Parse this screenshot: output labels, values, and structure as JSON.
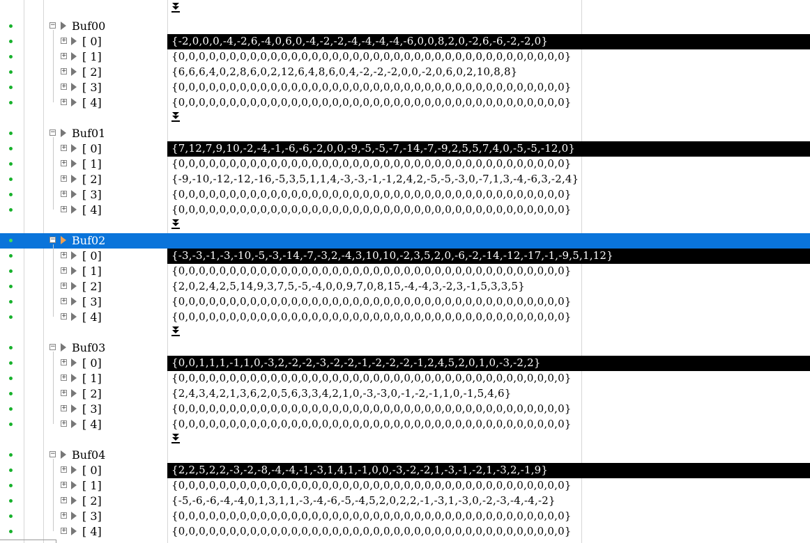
{
  "selected_group": "Buf02",
  "groups": [
    {
      "name": "Buf00",
      "items": [
        {
          "label": "[ 0]",
          "value": "{-2,0,0,0,-4,-2,6,-4,0,6,0,-4,-2,-2,-4,-4,-4,-4,-6,0,0,8,2,0,-2,6,-6,-2,-2,0}",
          "highlight": true
        },
        {
          "label": "[ 1]",
          "value": "{0,0,0,0,0,0,0,0,0,0,0,0,0,0,0,0,0,0,0,0,0,0,0,0,0,0,0,0,0,0,0,0,0,0,0,0,0,0}",
          "highlight": false
        },
        {
          "label": "[ 2]",
          "value": "{6,6,6,4,0,2,8,6,0,2,12,6,4,8,6,0,4,-2,-2,-2,0,0,-2,0,6,0,2,10,8,8}",
          "highlight": false
        },
        {
          "label": "[ 3]",
          "value": "{0,0,0,0,0,0,0,0,0,0,0,0,0,0,0,0,0,0,0,0,0,0,0,0,0,0,0,0,0,0,0,0,0,0,0,0,0,0}",
          "highlight": false
        },
        {
          "label": "[ 4]",
          "value": "{0,0,0,0,0,0,0,0,0,0,0,0,0,0,0,0,0,0,0,0,0,0,0,0,0,0,0,0,0,0,0,0,0,0,0,0,0,0}",
          "highlight": false
        }
      ]
    },
    {
      "name": "Buf01",
      "items": [
        {
          "label": "[ 0]",
          "value": "{7,12,7,9,10,-2,-4,-1,-6,-6,-2,0,0,-9,-5,-5,-7,-14,-7,-9,2,5,5,7,4,0,-5,-5,-12,0}",
          "highlight": true
        },
        {
          "label": "[ 1]",
          "value": "{0,0,0,0,0,0,0,0,0,0,0,0,0,0,0,0,0,0,0,0,0,0,0,0,0,0,0,0,0,0,0,0,0,0,0,0,0,0}",
          "highlight": false
        },
        {
          "label": "[ 2]",
          "value": "{-9,-10,-12,-12,-16,-5,3,5,1,1,4,-3,-3,-1,-1,2,4,2,-5,-5,-3,0,-7,1,3,-4,-6,3,-2,4}",
          "highlight": false
        },
        {
          "label": "[ 3]",
          "value": "{0,0,0,0,0,0,0,0,0,0,0,0,0,0,0,0,0,0,0,0,0,0,0,0,0,0,0,0,0,0,0,0,0,0,0,0,0,0}",
          "highlight": false
        },
        {
          "label": "[ 4]",
          "value": "{0,0,0,0,0,0,0,0,0,0,0,0,0,0,0,0,0,0,0,0,0,0,0,0,0,0,0,0,0,0,0,0,0,0,0,0,0,0}",
          "highlight": false
        }
      ]
    },
    {
      "name": "Buf02",
      "items": [
        {
          "label": "[ 0]",
          "value": "{-3,-3,-1,-3,-10,-5,-3,-14,-7,-3,2,-4,3,10,10,-2,3,5,2,0,-6,-2,-14,-12,-17,-1,-9,5,1,12}",
          "highlight": true
        },
        {
          "label": "[ 1]",
          "value": "{0,0,0,0,0,0,0,0,0,0,0,0,0,0,0,0,0,0,0,0,0,0,0,0,0,0,0,0,0,0,0,0,0,0,0,0,0,0}",
          "highlight": false
        },
        {
          "label": "[ 2]",
          "value": "{2,0,2,4,2,5,14,9,3,7,5,-5,-4,0,0,9,7,0,8,15,-4,-4,3,-2,3,-1,5,3,3,5}",
          "highlight": false
        },
        {
          "label": "[ 3]",
          "value": "{0,0,0,0,0,0,0,0,0,0,0,0,0,0,0,0,0,0,0,0,0,0,0,0,0,0,0,0,0,0,0,0,0,0,0,0,0,0}",
          "highlight": false
        },
        {
          "label": "[ 4]",
          "value": "{0,0,0,0,0,0,0,0,0,0,0,0,0,0,0,0,0,0,0,0,0,0,0,0,0,0,0,0,0,0,0,0,0,0,0,0,0,0}",
          "highlight": false
        }
      ]
    },
    {
      "name": "Buf03",
      "items": [
        {
          "label": "[ 0]",
          "value": "{0,0,1,1,1,-1,1,0,-3,2,-2,-2,-3,-2,-2,-1,-2,-2,-2,-1,2,4,5,2,0,1,0,-3,-2,2}",
          "highlight": true
        },
        {
          "label": "[ 1]",
          "value": "{0,0,0,0,0,0,0,0,0,0,0,0,0,0,0,0,0,0,0,0,0,0,0,0,0,0,0,0,0,0,0,0,0,0,0,0,0,0}",
          "highlight": false
        },
        {
          "label": "[ 2]",
          "value": "{2,4,3,4,2,1,3,6,2,0,5,6,3,3,4,2,1,0,-3,-3,0,-1,-2,-1,1,0,-1,5,4,6}",
          "highlight": false
        },
        {
          "label": "[ 3]",
          "value": "{0,0,0,0,0,0,0,0,0,0,0,0,0,0,0,0,0,0,0,0,0,0,0,0,0,0,0,0,0,0,0,0,0,0,0,0,0,0}",
          "highlight": false
        },
        {
          "label": "[ 4]",
          "value": "{0,0,0,0,0,0,0,0,0,0,0,0,0,0,0,0,0,0,0,0,0,0,0,0,0,0,0,0,0,0,0,0,0,0,0,0,0,0}",
          "highlight": false
        }
      ]
    },
    {
      "name": "Buf04",
      "items": [
        {
          "label": "[ 0]",
          "value": "{2,2,5,2,2,-3,-2,-8,-4,-4,-1,-3,1,4,1,-1,0,0,-3,-2,-2,1,-3,-1,-2,1,-3,2,-1,9}",
          "highlight": true
        },
        {
          "label": "[ 1]",
          "value": "{0,0,0,0,0,0,0,0,0,0,0,0,0,0,0,0,0,0,0,0,0,0,0,0,0,0,0,0,0,0,0,0,0,0,0,0,0,0}",
          "highlight": false
        },
        {
          "label": "[ 2]",
          "value": "{-5,-6,-6,-4,-4,0,1,3,1,1,-3,-4,-6,-5,-4,5,2,0,2,2,-1,-3,1,-3,0,-2,-3,-4,-4,-2}",
          "highlight": false
        },
        {
          "label": "[ 3]",
          "value": "{0,0,0,0,0,0,0,0,0,0,0,0,0,0,0,0,0,0,0,0,0,0,0,0,0,0,0,0,0,0,0,0,0,0,0,0,0,0}",
          "highlight": false
        },
        {
          "label": "[ 4]",
          "value": "{0,0,0,0,0,0,0,0,0,0,0,0,0,0,0,0,0,0,0,0,0,0,0,0,0,0,0,0,0,0,0,0,0,0,0,0,0,0}",
          "highlight": false
        }
      ]
    }
  ],
  "icons": {
    "expand": "plus-box-icon",
    "collapse": "minus-box-icon",
    "node": "arrow-node-icon",
    "more": "show-more-icon"
  }
}
